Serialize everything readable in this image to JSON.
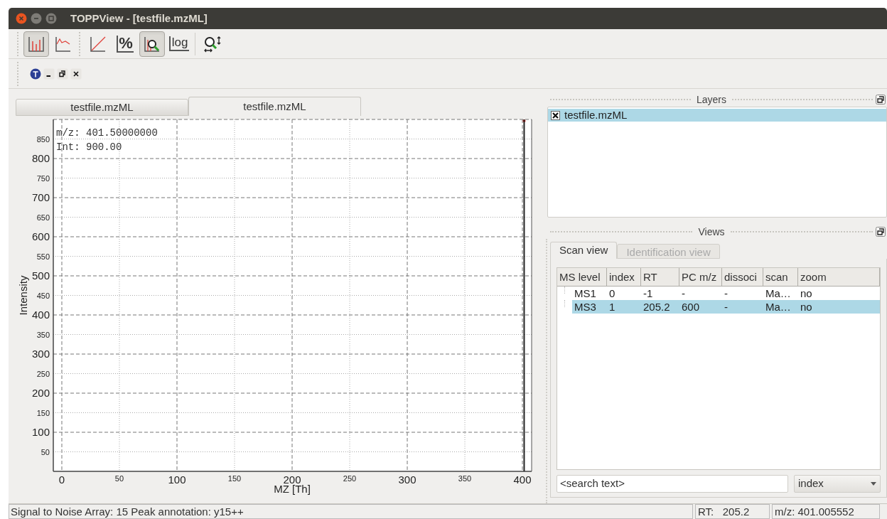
{
  "window": {
    "title": "TOPPView - [testfile.mzML]"
  },
  "toolbar": {
    "groups": [
      {
        "buttons": [
          {
            "kind": "sticks",
            "selected": true
          },
          {
            "kind": "profile",
            "selected": false
          }
        ]
      },
      {
        "buttons": [
          {
            "kind": "linear",
            "selected": false
          },
          {
            "kind": "percent",
            "label": "%",
            "selected": false
          },
          {
            "kind": "snap",
            "selected": true
          },
          {
            "kind": "log",
            "label": "log",
            "selected": false
          }
        ]
      },
      {
        "buttons": [
          {
            "kind": "zoom",
            "selected": false
          }
        ]
      }
    ]
  },
  "spectrum_tabs": [
    {
      "label": "testfile.mzML",
      "selected": false
    },
    {
      "label": "testfile.mzML",
      "selected": true
    }
  ],
  "spectrum": {
    "annotation": [
      "m/z: 401.50000000",
      "Int: 900.00"
    ],
    "chart_data": {
      "type": "bar",
      "grid": true,
      "xlabel": "MZ [Th]",
      "ylabel": "Intensity",
      "x": [
        401.5
      ],
      "values": [
        900
      ],
      "xlim": [
        -7.4,
        408
      ],
      "ylim": [
        0,
        900
      ],
      "xticks": [
        0,
        50,
        100,
        150,
        200,
        250,
        300,
        350,
        400
      ],
      "yticks": [
        50,
        100,
        150,
        200,
        250,
        300,
        350,
        400,
        450,
        500,
        550,
        600,
        650,
        700,
        750,
        800,
        850
      ]
    }
  },
  "layers": {
    "title": "Layers",
    "items": [
      {
        "label": "testfile.mzML",
        "checked": true,
        "selected": true
      }
    ]
  },
  "views": {
    "title": "Views",
    "tabs": [
      {
        "label": "Scan view",
        "selected": true,
        "disabled": false
      },
      {
        "label": "Identification view",
        "selected": false,
        "disabled": true
      }
    ],
    "table": {
      "columns": [
        "MS level",
        "index",
        "RT",
        "PC m/z",
        "dissoci",
        "scan",
        "zoom"
      ],
      "rows": [
        {
          "cells": [
            "MS1",
            "0",
            "-1",
            "-",
            "-",
            "Ma…",
            "no"
          ],
          "selected": false
        },
        {
          "cells": [
            "MS3",
            "1",
            "205.2",
            "600",
            "-",
            "Ma…",
            "no"
          ],
          "selected": true
        }
      ]
    },
    "search": {
      "placeholder": "<search text>"
    },
    "sort_by": {
      "value": "index"
    }
  },
  "status_bar": {
    "message": "Signal to Noise Array: 15 Peak annotation: y15++",
    "rt": "RT:   205.2",
    "mz": "m/z: 401.005552"
  }
}
